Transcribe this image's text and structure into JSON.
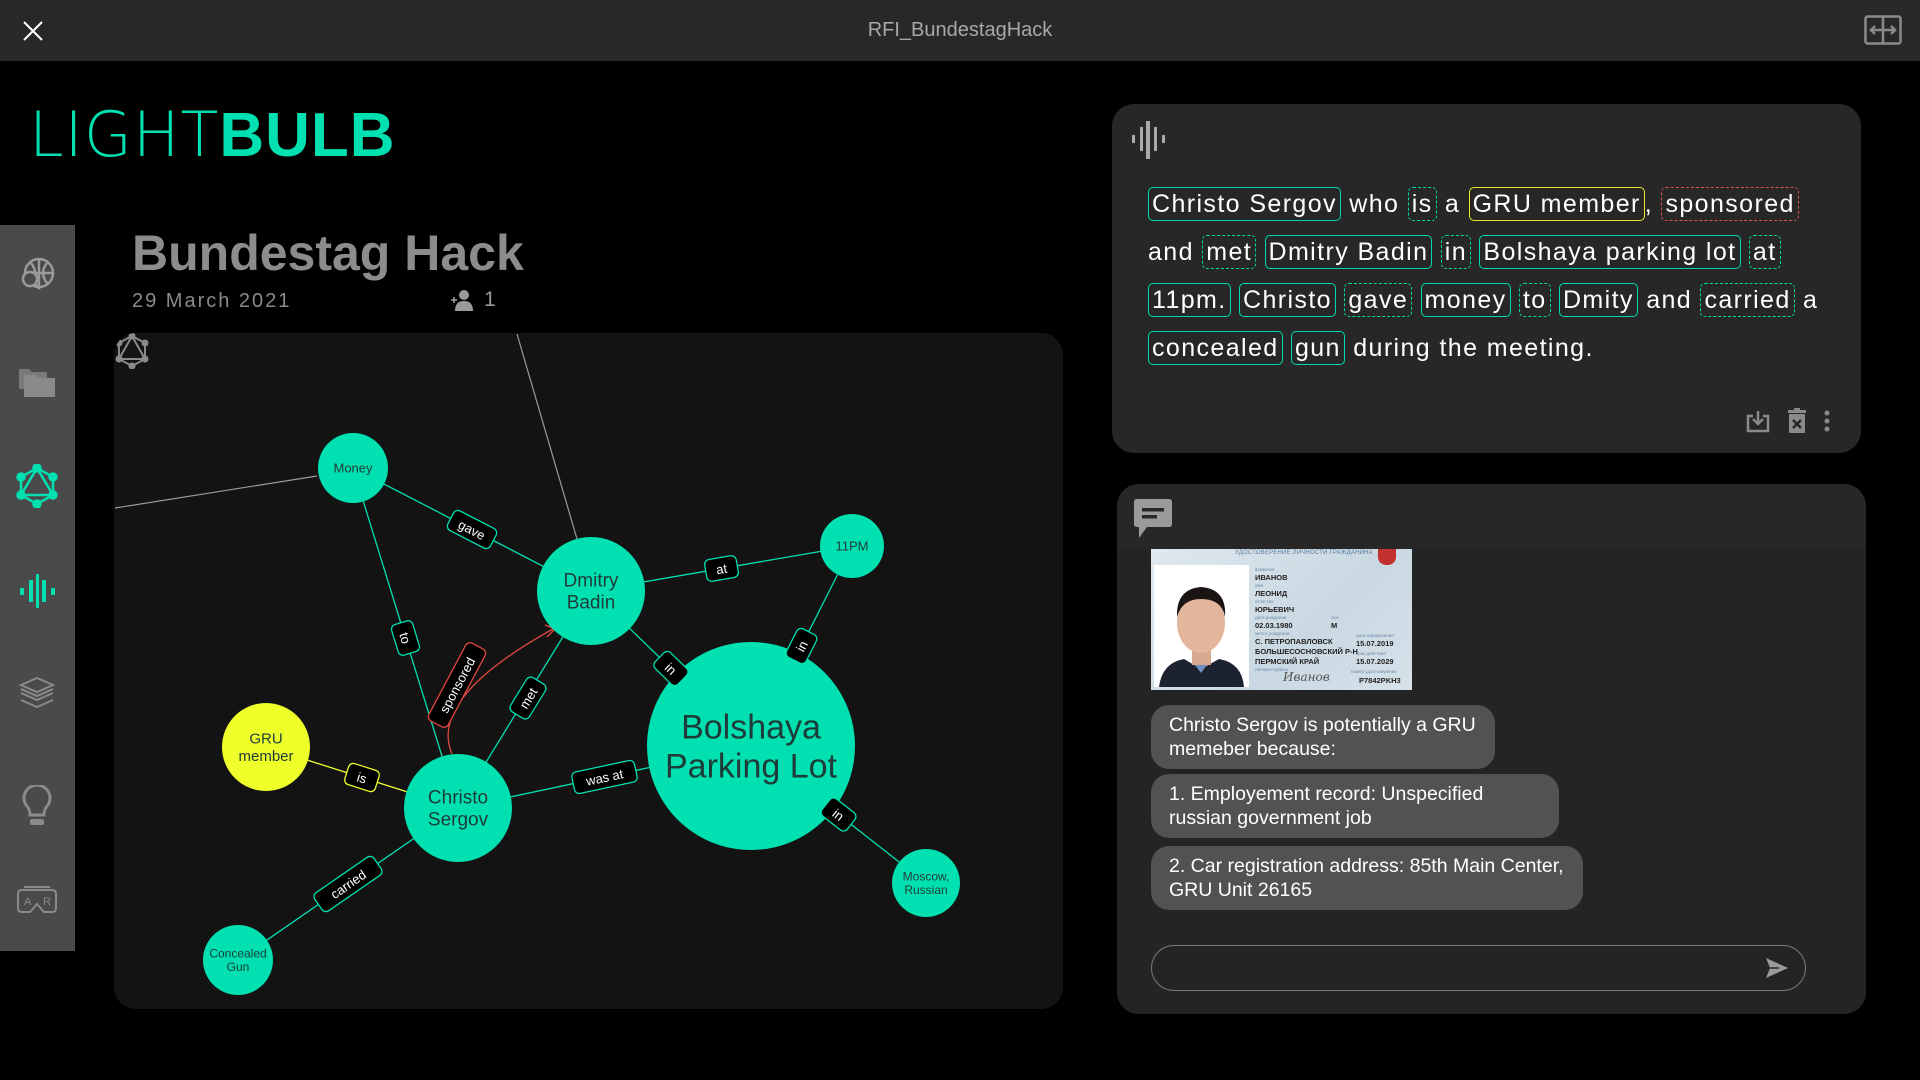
{
  "window": {
    "title": "RFI_BundestagHack"
  },
  "logo": {
    "light": "LIGHT",
    "bold": "BULB",
    "color": "#00e0b0"
  },
  "sidebar": {
    "items": [
      {
        "id": "global-search",
        "icon": "globe-search-icon",
        "active": false
      },
      {
        "id": "files",
        "icon": "folder-icon",
        "active": false
      },
      {
        "id": "graph",
        "icon": "graph-icon",
        "active": true
      },
      {
        "id": "audio",
        "icon": "audio-wave-icon",
        "active": true
      },
      {
        "id": "layers",
        "icon": "layers-icon",
        "active": false
      },
      {
        "id": "insights",
        "icon": "lightbulb-icon",
        "active": false
      },
      {
        "id": "ar",
        "icon": "ar-headset-icon",
        "active": false
      }
    ]
  },
  "project": {
    "title": "Bundestag Hack",
    "date": "29 March 2021",
    "collaborators": "1"
  },
  "colors": {
    "accent": "#00e0b0",
    "attribute": "#eeff2a",
    "flagged": "#e0483f",
    "panel": "#272727"
  },
  "graph": {
    "nodes": [
      {
        "id": "money",
        "label": "Money",
        "kind": "entity"
      },
      {
        "id": "dmitry",
        "label": "Dmitry Badin",
        "kind": "entity"
      },
      {
        "id": "11pm",
        "label": "11PM",
        "kind": "entity"
      },
      {
        "id": "bolshaya",
        "label": "Bolshaya Parking Lot",
        "kind": "entity"
      },
      {
        "id": "gru",
        "label": "GRU member",
        "kind": "attribute"
      },
      {
        "id": "christo",
        "label": "Christo Sergov",
        "kind": "entity"
      },
      {
        "id": "moscow",
        "label": "Moscow, Russian",
        "kind": "entity"
      },
      {
        "id": "gun",
        "label": "Concealed Gun",
        "kind": "entity"
      }
    ],
    "edges": [
      {
        "from": "money",
        "to": "dmitry",
        "label": "gave",
        "kind": "relation"
      },
      {
        "from": "money",
        "to": "christo",
        "label": "to",
        "kind": "relation"
      },
      {
        "from": "dmitry",
        "to": "11pm",
        "label": "at",
        "kind": "relation"
      },
      {
        "from": "dmitry",
        "to": "bolshaya",
        "label": "in",
        "kind": "relation"
      },
      {
        "from": "11pm",
        "to": "bolshaya",
        "label": "in",
        "kind": "relation"
      },
      {
        "from": "christo",
        "to": "dmitry",
        "label": "met",
        "kind": "relation"
      },
      {
        "from": "christo",
        "to": "dmitry",
        "label": "sponsored",
        "kind": "flagged"
      },
      {
        "from": "gru",
        "to": "christo",
        "label": "is",
        "kind": "attribute"
      },
      {
        "from": "christo",
        "to": "bolshaya",
        "label": "was at",
        "kind": "relation"
      },
      {
        "from": "christo",
        "to": "gun",
        "label": "carried",
        "kind": "relation"
      },
      {
        "from": "bolshaya",
        "to": "moscow",
        "label": "in",
        "kind": "relation"
      }
    ]
  },
  "transcript": {
    "tokens": [
      {
        "text": "Christo Sergov",
        "kind": "entity"
      },
      {
        "text": " who ",
        "kind": "plain"
      },
      {
        "text": "is",
        "kind": "relation"
      },
      {
        "text": " a ",
        "kind": "plain"
      },
      {
        "text": "GRU member",
        "kind": "attribute"
      },
      {
        "text": ", ",
        "kind": "plain"
      },
      {
        "text": "sponsored",
        "kind": "flagged"
      },
      {
        "text": " and ",
        "kind": "plain"
      },
      {
        "text": "met",
        "kind": "relation"
      },
      {
        "text": " ",
        "kind": "plain"
      },
      {
        "text": "Dmitry Badin",
        "kind": "entity"
      },
      {
        "text": " ",
        "kind": "plain"
      },
      {
        "text": "in",
        "kind": "relation"
      },
      {
        "text": " ",
        "kind": "plain"
      },
      {
        "text": "Bolshaya parking lot",
        "kind": "entity"
      },
      {
        "text": " ",
        "kind": "plain"
      },
      {
        "text": "at",
        "kind": "relation"
      },
      {
        "text": " ",
        "kind": "plain"
      },
      {
        "text": "11pm.",
        "kind": "entity"
      },
      {
        "text": " ",
        "kind": "plain"
      },
      {
        "text": "Christo",
        "kind": "entity"
      },
      {
        "text": " ",
        "kind": "plain"
      },
      {
        "text": "gave",
        "kind": "relation"
      },
      {
        "text": " ",
        "kind": "plain"
      },
      {
        "text": "money",
        "kind": "entity"
      },
      {
        "text": " ",
        "kind": "plain"
      },
      {
        "text": "to",
        "kind": "relation"
      },
      {
        "text": " ",
        "kind": "plain"
      },
      {
        "text": "Dmity",
        "kind": "entity"
      },
      {
        "text": " and ",
        "kind": "plain"
      },
      {
        "text": "carried",
        "kind": "relation"
      },
      {
        "text": " a ",
        "kind": "plain"
      },
      {
        "text": "concealed",
        "kind": "entity"
      },
      {
        "text": " ",
        "kind": "plain"
      },
      {
        "text": "gun",
        "kind": "entity"
      },
      {
        "text": " during the meeting.",
        "kind": "plain"
      }
    ]
  },
  "chat": {
    "id_card": {
      "header": "УДОСТОВЕРЕНИЕ ЛИЧНОСТИ ГРАЖДАНИНА",
      "surname_label": "фамилия",
      "surname": "ИВАНОВ",
      "name_label": "имя",
      "name": "ЛЕОНИД",
      "patronymic_label": "отчество",
      "patronymic": "ЮРЬЕВИЧ",
      "dob_label": "дата рождения",
      "dob": "02.03.1980",
      "sex_label": "пол",
      "sex": "М",
      "pob_label": "место рождения",
      "pob": [
        "С. ПЕТРОПАВЛОВСК",
        "БОЛЬШЕСОСНОВСКИЙ Р-Н",
        "ПЕРМСКИЙ КРАЙ"
      ],
      "issued_label": "дата оформления",
      "issued": "15.07.2019",
      "expiry_label": "срок действия",
      "expiry": "15.07.2029",
      "signature_label": "личная подпись",
      "signature": "Иванов",
      "number_label": "номер удостоверения",
      "number": "P7842PKH3"
    },
    "messages": [
      "Christo Sergov is potentially a GRU memeber because:",
      "1. Employement record: Unspecified russian government job",
      "2. Car registration address: 85th Main Center, GRU Unit 26165"
    ],
    "input": {
      "value": "",
      "placeholder": ""
    },
    "scroll_position": 0.95
  }
}
